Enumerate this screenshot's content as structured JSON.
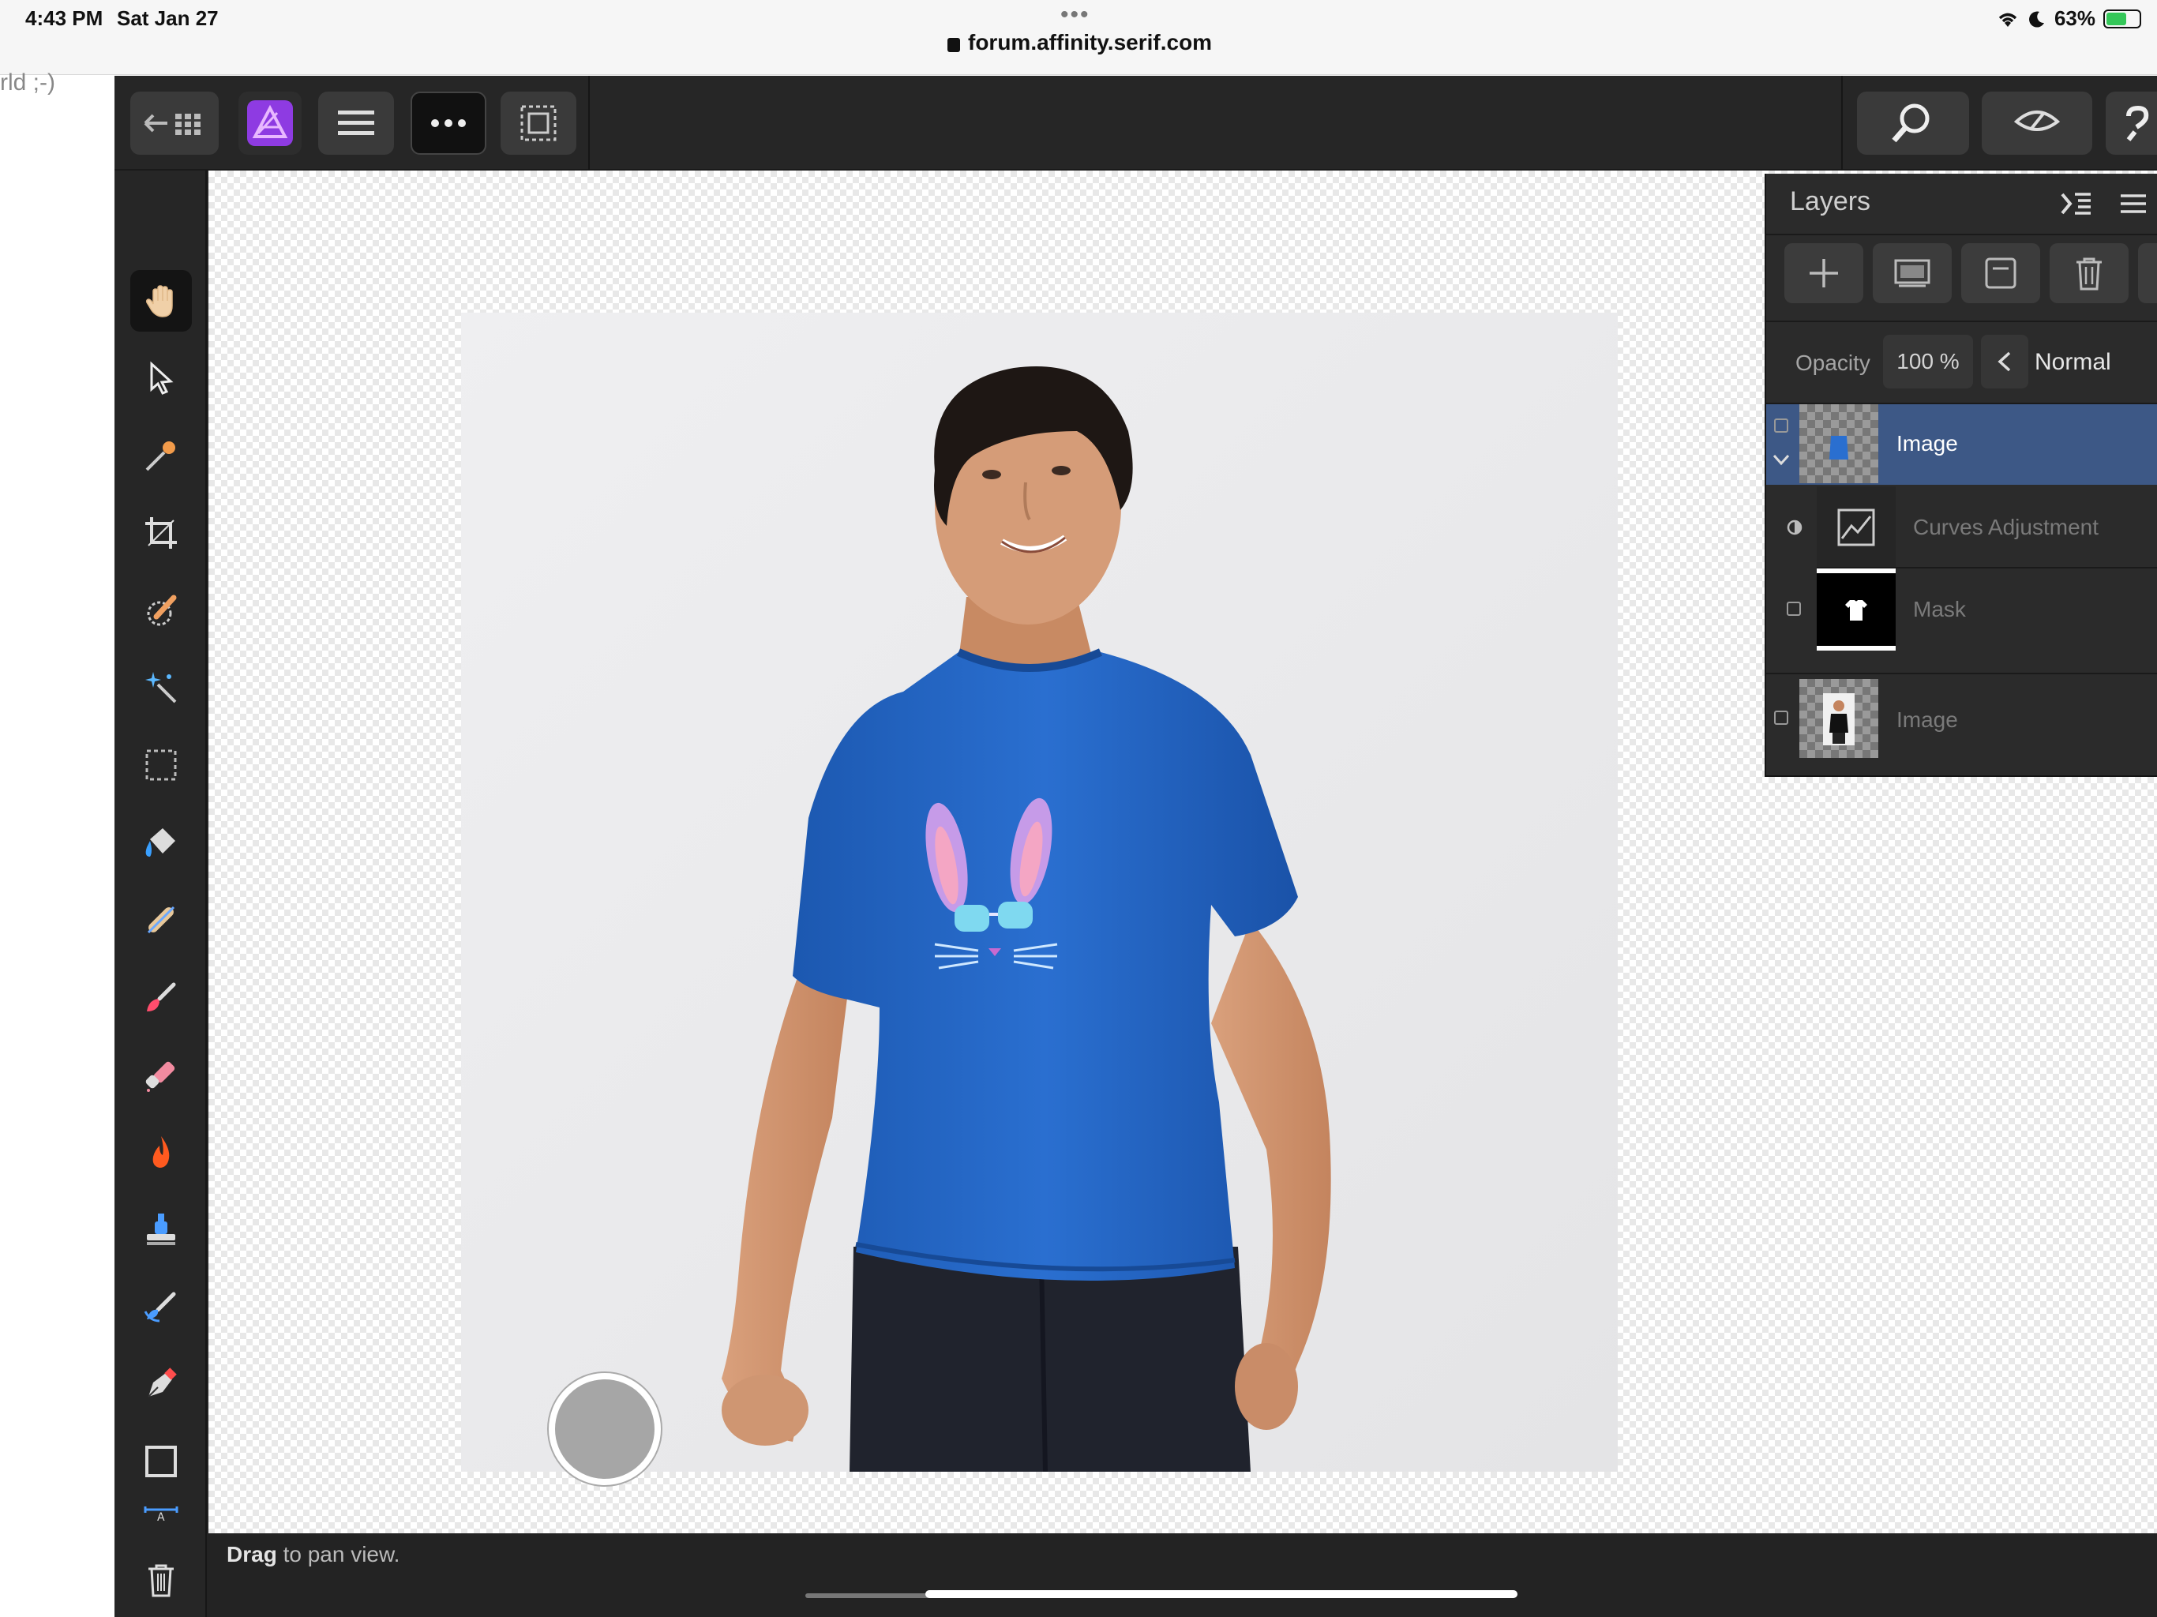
{
  "status_bar": {
    "time": "4:43 PM",
    "date": "Sat Jan 27",
    "url": "forum.affinity.serif.com",
    "battery": "63%",
    "battery_level": 0.63
  },
  "page_fragment": "rld ;-)",
  "app": {
    "name": "Affinity Photo",
    "top_toolbar": {
      "icons": [
        "back-to-documents-icon",
        "affinity-photo-persona-icon",
        "hamburger-menu-icon",
        "more-options-icon",
        "selection-marquee-icon",
        "zoom-icon",
        "view-mode-icon",
        "help-icon"
      ]
    },
    "tools": [
      "hand-tool-icon",
      "move-tool-icon",
      "color-picker-tool-icon",
      "crop-tool-icon",
      "selection-brush-tool-icon",
      "flood-select-tool-icon",
      "marquee-tool-icon",
      "flood-fill-tool-icon",
      "healing-brush-tool-icon",
      "paint-brush-tool-icon",
      "erase-brush-tool-icon",
      "dodge-brush-tool-icon",
      "clone-brush-tool-icon",
      "smudge-brush-tool-icon",
      "pen-tool-icon",
      "rectangle-tool-icon",
      "text-tool-icon",
      "trash-icon"
    ],
    "status_hint": {
      "bold": "Drag",
      "rest": " to pan view."
    },
    "layers_panel": {
      "title": "Layers",
      "opacity_label": "Opacity",
      "opacity_value": "100 %",
      "blend_mode": "Normal",
      "layers": [
        {
          "name": "Image",
          "selected": true
        },
        {
          "name": "Curves Adjustment",
          "selected": false
        },
        {
          "name": "Mask",
          "selected": false
        },
        {
          "name": "Image",
          "selected": false
        }
      ]
    }
  },
  "colors": {
    "selected_layer": "#3d5886",
    "shirt_blue": "#2266c4",
    "accent_purple": "#9b3fe0"
  }
}
